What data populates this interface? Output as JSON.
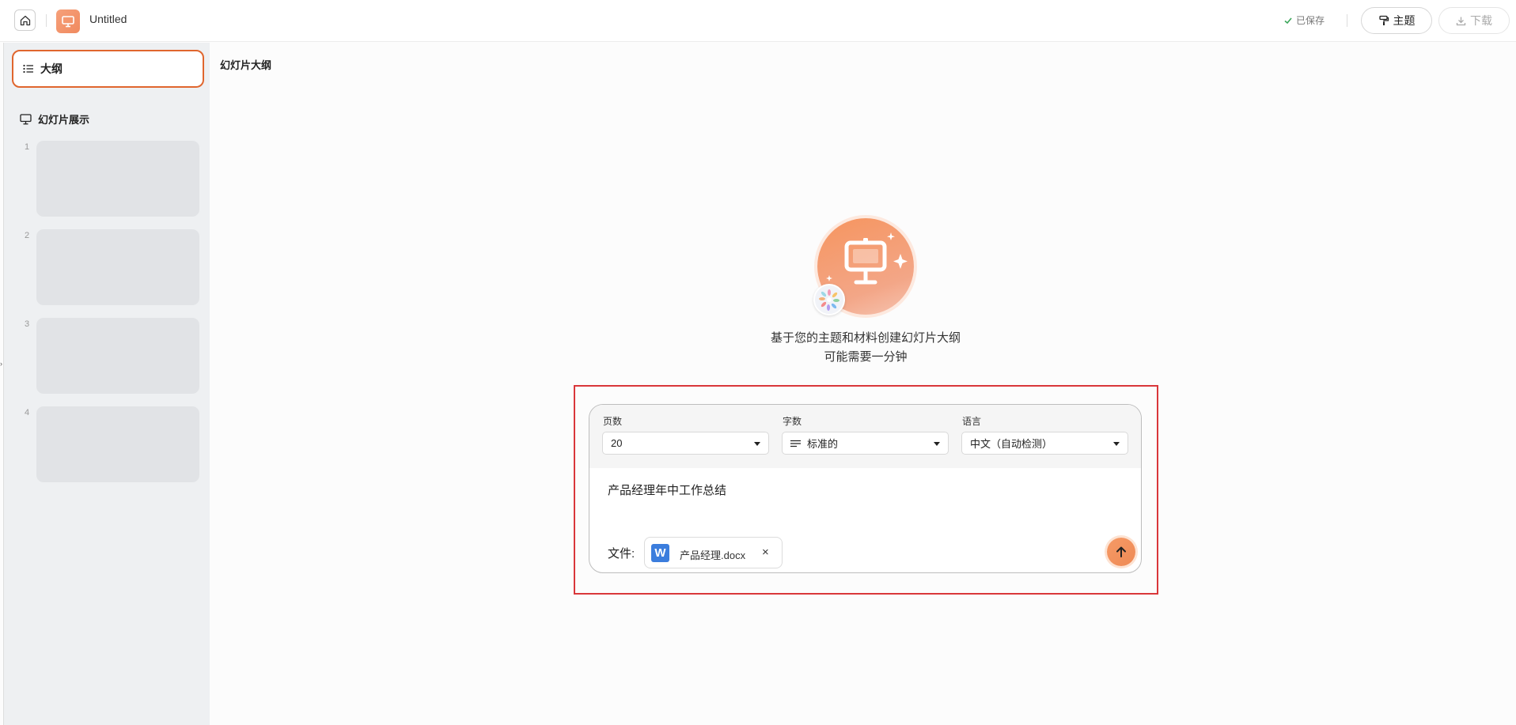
{
  "header": {
    "title": "Untitled",
    "saved_status": "已保存",
    "theme_label": "主题",
    "download_label": "下载"
  },
  "sidebar": {
    "outline_tab": "大纲",
    "slides_heading": "幻灯片展示",
    "thumbnails": [
      "1",
      "2",
      "3",
      "4"
    ]
  },
  "main": {
    "heading": "幻灯片大纲",
    "hero_line1": "基于您的主题和材料创建幻灯片大纲",
    "hero_line2": "可能需要一分钟"
  },
  "generator": {
    "pages": {
      "label": "页数",
      "value": "20"
    },
    "words": {
      "label": "字数",
      "value": "标准的"
    },
    "language": {
      "label": "语言",
      "value": "中文（自动检测）"
    },
    "prompt": "产品经理年中工作总结",
    "file_label": "文件:",
    "file_icon_letter": "W",
    "file_name": "产品经理.docx",
    "file_remove": "×"
  },
  "colors": {
    "accent": "#ee8a55",
    "highlight_border": "#d9373a",
    "outline_tab_border": "#e0662e",
    "word_blue": "#3b7ddd"
  }
}
